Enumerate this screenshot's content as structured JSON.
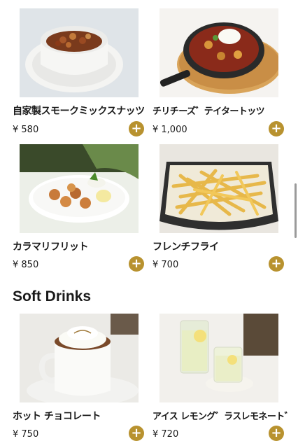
{
  "currency_symbol": "¥",
  "colors": {
    "accent": "#b8922f"
  },
  "add_button_icon": "plus-circle-icon",
  "items": [
    {
      "name": "自家製スモークミックスナッツ",
      "price": "¥ 580"
    },
    {
      "name": "チリチーズ゛テイタートッツ",
      "price": "¥ 1,000"
    },
    {
      "name": "カラマリフリット",
      "price": "¥ 850"
    },
    {
      "name": "フレンチフライ",
      "price": "¥ 700"
    }
  ],
  "soft_drinks": {
    "title": "Soft Drinks",
    "items": [
      {
        "name": "ホット チョコレート",
        "price": "¥ 750"
      },
      {
        "name": "アイス レモング゛ラスレモネート゛",
        "price": "¥ 720"
      }
    ]
  },
  "add_label": "+"
}
